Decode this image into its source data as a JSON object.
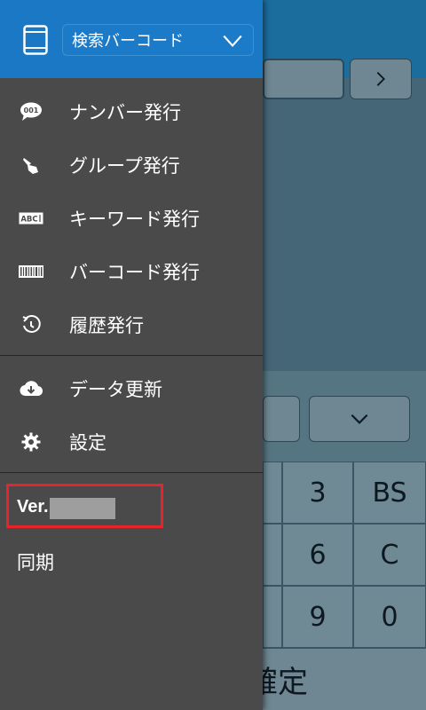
{
  "drawer": {
    "mode_select": {
      "value": "検索バーコード"
    },
    "menu": [
      {
        "label": "ナンバー発行",
        "icon": "number-bubble-icon"
      },
      {
        "label": "グループ発行",
        "icon": "hand-pointer-icon"
      },
      {
        "label": "キーワード発行",
        "icon": "abc-keyword-icon"
      },
      {
        "label": "バーコード発行",
        "icon": "barcode-icon"
      },
      {
        "label": "履歴発行",
        "icon": "history-icon"
      },
      {
        "label": "データ更新",
        "icon": "cloud-download-icon"
      },
      {
        "label": "設定",
        "icon": "gear-icon"
      }
    ],
    "version_label": "Ver.",
    "sync_label": "同期",
    "number_icon_text": "001",
    "abc_icon_text": "ABC"
  },
  "background": {
    "keys": [
      "3",
      "BS",
      "6",
      "C",
      "9",
      "0"
    ],
    "confirm_label": "確定"
  },
  "colors": {
    "drawer_bg": "#4a4a4a",
    "drawer_header": "#1b78c4",
    "highlight_box": "#e8232a"
  }
}
